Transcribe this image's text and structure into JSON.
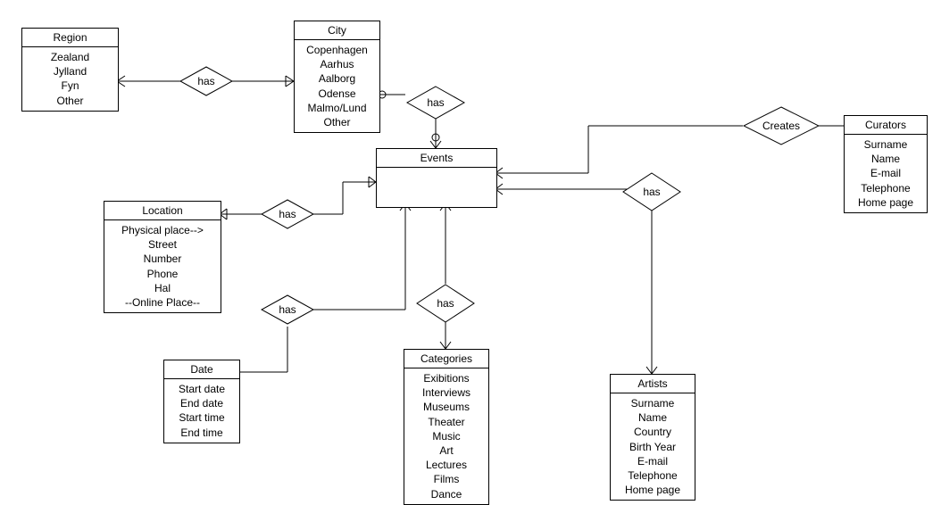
{
  "entities": {
    "region": {
      "title": "Region",
      "attrs": [
        "Zealand",
        "Jylland",
        "Fyn",
        "Other"
      ]
    },
    "city": {
      "title": "City",
      "attrs": [
        "Copenhagen",
        "Aarhus",
        "Aalborg",
        "Odense",
        "Malmo/Lund",
        "Other"
      ]
    },
    "events": {
      "title": "Events",
      "attrs": []
    },
    "location": {
      "title": "Location",
      "attrs": [
        "Physical place-->",
        "Street",
        "Number",
        "Phone",
        "Hal",
        "--Online Place--"
      ]
    },
    "date": {
      "title": "Date",
      "attrs": [
        "Start date",
        "End date",
        "Start time",
        "End time"
      ]
    },
    "categories": {
      "title": "Categories",
      "attrs": [
        "Exibitions",
        "Interviews",
        "Museums",
        "Theater",
        "Music",
        "Art",
        "Lectures",
        "Films",
        "Dance"
      ]
    },
    "artists": {
      "title": "Artists",
      "attrs": [
        "Surname",
        "Name",
        "Country",
        "Birth Year",
        "E-mail",
        "Telephone",
        "Home page"
      ]
    },
    "curators": {
      "title": "Curators",
      "attrs": [
        "Surname",
        "Name",
        "E-mail",
        "Telephone",
        "Home page"
      ]
    }
  },
  "relationships": {
    "region_city": "has",
    "city_events": "has",
    "location_events": "has",
    "date_events": "has",
    "categories_events": "has",
    "artists_events": "has",
    "curators_events": "Creates"
  }
}
